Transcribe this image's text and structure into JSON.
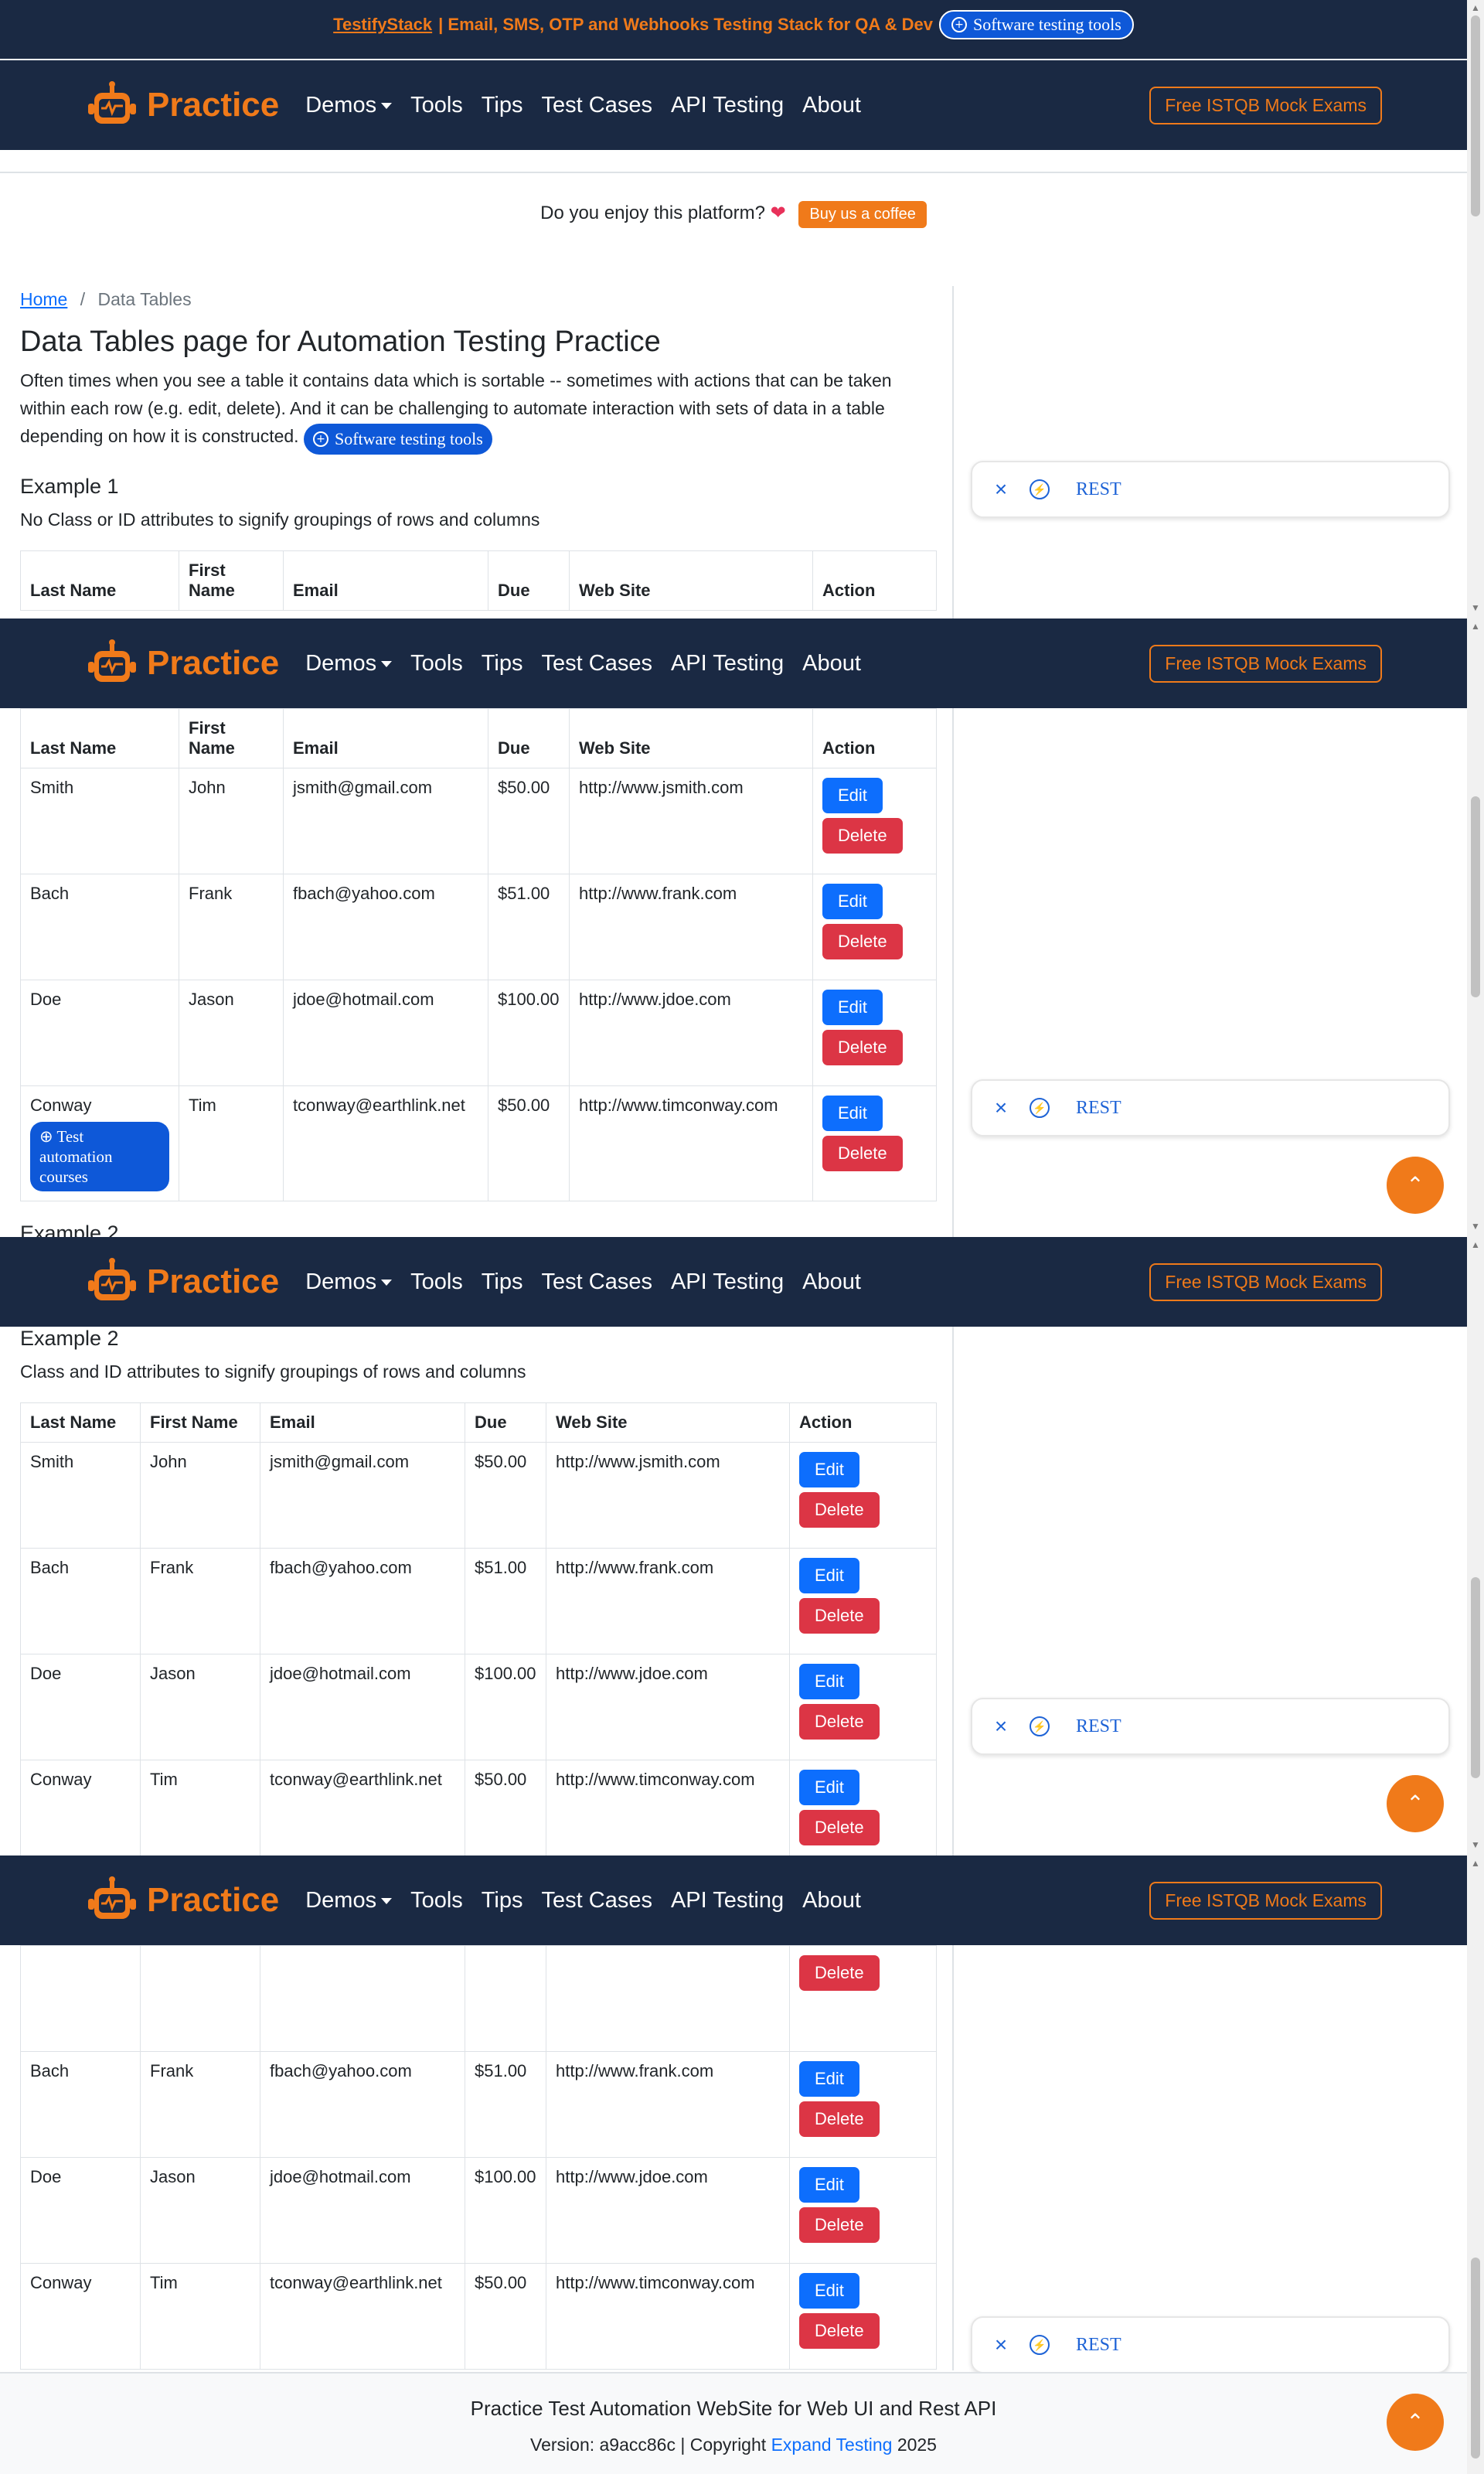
{
  "banner": {
    "brand": "TestifyStack",
    "tagline": "| Email, SMS, OTP and Webhooks Testing Stack for QA & Dev",
    "pill_label": "Software testing tools"
  },
  "nav": {
    "logo_text": "Practice",
    "links": [
      "Demos",
      "Tools",
      "Tips",
      "Test Cases",
      "API Testing",
      "About"
    ],
    "cta": "Free ISTQB Mock Exams"
  },
  "coffee": {
    "question": "Do you enjoy this platform?",
    "button": "Buy us a coffee"
  },
  "breadcrumb": {
    "home": "Home",
    "sep": "/",
    "current": "Data Tables"
  },
  "page": {
    "title": "Data Tables page for Automation Testing Practice",
    "description": "Often times when you see a table it contains data which is sortable -- sometimes with actions that can be taken within each row (e.g. edit, delete). And it can be challenging to automate interaction with sets of data in a table depending on how it is constructed.",
    "tools_pill": "Software testing tools"
  },
  "example1": {
    "heading": "Example 1",
    "subtitle": "No Class or ID attributes to signify groupings of rows and columns"
  },
  "example2": {
    "heading": "Example 2",
    "subtitle": "Class and ID attributes to signify groupings of rows and columns"
  },
  "table": {
    "headers": [
      "Last Name",
      "First Name",
      "Email",
      "Due",
      "Web Site",
      "Action"
    ],
    "edit_label": "Edit",
    "delete_label": "Delete",
    "rows": [
      {
        "last": "Smith",
        "first": "John",
        "email": "jsmith@gmail.com",
        "due": "$50.00",
        "web": "http://www.jsmith.com"
      },
      {
        "last": "Bach",
        "first": "Frank",
        "email": "fbach@yahoo.com",
        "due": "$51.00",
        "web": "http://www.frank.com"
      },
      {
        "last": "Doe",
        "first": "Jason",
        "email": "jdoe@hotmail.com",
        "due": "$100.00",
        "web": "http://www.jdoe.com"
      },
      {
        "last": "Conway",
        "first": "Tim",
        "email": "tconway@earthlink.net",
        "due": "$50.00",
        "web": "http://www.timconway.com"
      }
    ]
  },
  "course_badge": "Test automation courses",
  "widget": {
    "close": "×",
    "label": "REST"
  },
  "footer": {
    "line1": "Practice Test Automation WebSite for Web UI and Rest API",
    "version_prefix": "Version: a9acc86c | Copyright",
    "company": "Expand Testing",
    "year": "2025"
  },
  "colors": {
    "navy": "#1a2943",
    "orange": "#f07a1a",
    "blue": "#0d6efd",
    "red": "#dc3545"
  },
  "icons": {
    "logo": "robot-icon",
    "close": "close-icon",
    "bolt": "bolt-icon",
    "scroll_top": "chevron-up-icon",
    "pill": "plus-circle-icon"
  }
}
